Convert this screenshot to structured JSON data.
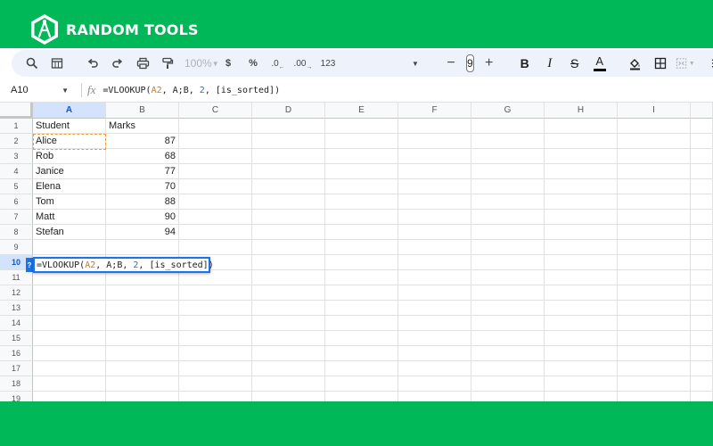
{
  "brand": {
    "name": "RANDOM TOOLS",
    "banner_color": "#00b858"
  },
  "toolbar": {
    "zoom": "100%",
    "currency": "$",
    "percent": "%",
    "decrease_decimal": ".0",
    "increase_decimal": ".00",
    "number_format": "123",
    "font_size": "9",
    "bold": "B",
    "italic": "I",
    "strikethrough": "S",
    "text_color": "A",
    "minus": "−",
    "plus": "+"
  },
  "formula_bar": {
    "name_box": "A10",
    "fx": "fx",
    "formula_prefix": "=VLOOKUP(",
    "formula_ref1": "A2",
    "formula_mid": ", A;B, ",
    "formula_index": "2",
    "formula_suffix": ", [is_sorted])"
  },
  "columns": [
    "A",
    "B",
    "C",
    "D",
    "E",
    "F",
    "G",
    "H",
    "I"
  ],
  "rows": [
    "1",
    "2",
    "3",
    "4",
    "5",
    "6",
    "7",
    "8",
    "9",
    "10",
    "11",
    "12",
    "13",
    "14",
    "15",
    "16",
    "17",
    "18",
    "19"
  ],
  "active_row": "10",
  "active_column": "A",
  "table": {
    "headers": [
      "Student",
      "Marks"
    ],
    "data": [
      {
        "student": "Alice",
        "marks": "87"
      },
      {
        "student": "Rob",
        "marks": "68"
      },
      {
        "student": "Janice",
        "marks": "77"
      },
      {
        "student": "Elena",
        "marks": "70"
      },
      {
        "student": "Tom",
        "marks": "88"
      },
      {
        "student": "Matt",
        "marks": "90"
      },
      {
        "student": "Stefan",
        "marks": "94"
      }
    ]
  },
  "editor": {
    "help_badge": "?",
    "formula_prefix": "=VLOOKUP(",
    "formula_ref1": "A2",
    "formula_mid": ", A;B, ",
    "formula_index": "2",
    "formula_suffix": ", [is_sorted])"
  },
  "colors": {
    "accent_blue": "#1a73e8",
    "ref_orange": "#e8710a"
  }
}
